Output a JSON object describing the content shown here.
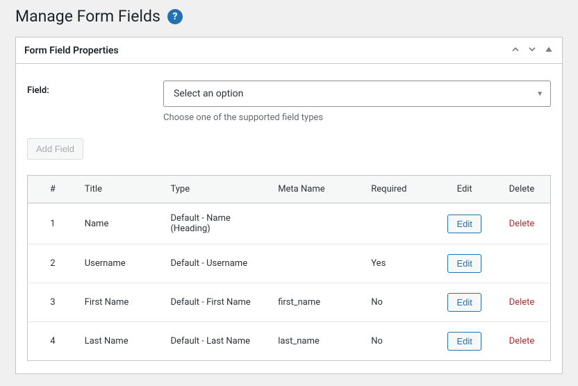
{
  "page": {
    "title": "Manage Form Fields"
  },
  "panel": {
    "title": "Form Field Properties"
  },
  "form": {
    "field_label": "Field:",
    "select_placeholder": "Select an option",
    "hint": "Choose one of the supported field types",
    "add_button": "Add Field"
  },
  "table": {
    "columns": {
      "index": "#",
      "title": "Title",
      "type": "Type",
      "meta": "Meta Name",
      "required": "Required",
      "edit": "Edit",
      "delete": "Delete"
    },
    "edit_label": "Edit",
    "delete_label": "Delete",
    "rows": [
      {
        "index": "1",
        "title": "Name",
        "type": "Default - Name (Heading)",
        "meta": "",
        "required": "",
        "can_delete": true
      },
      {
        "index": "2",
        "title": "Username",
        "type": "Default - Username",
        "meta": "",
        "required": "Yes",
        "can_delete": false
      },
      {
        "index": "3",
        "title": "First Name",
        "type": "Default - First Name",
        "meta": "first_name",
        "required": "No",
        "can_delete": true
      },
      {
        "index": "4",
        "title": "Last Name",
        "type": "Default - Last Name",
        "meta": "last_name",
        "required": "No",
        "can_delete": true
      }
    ]
  }
}
